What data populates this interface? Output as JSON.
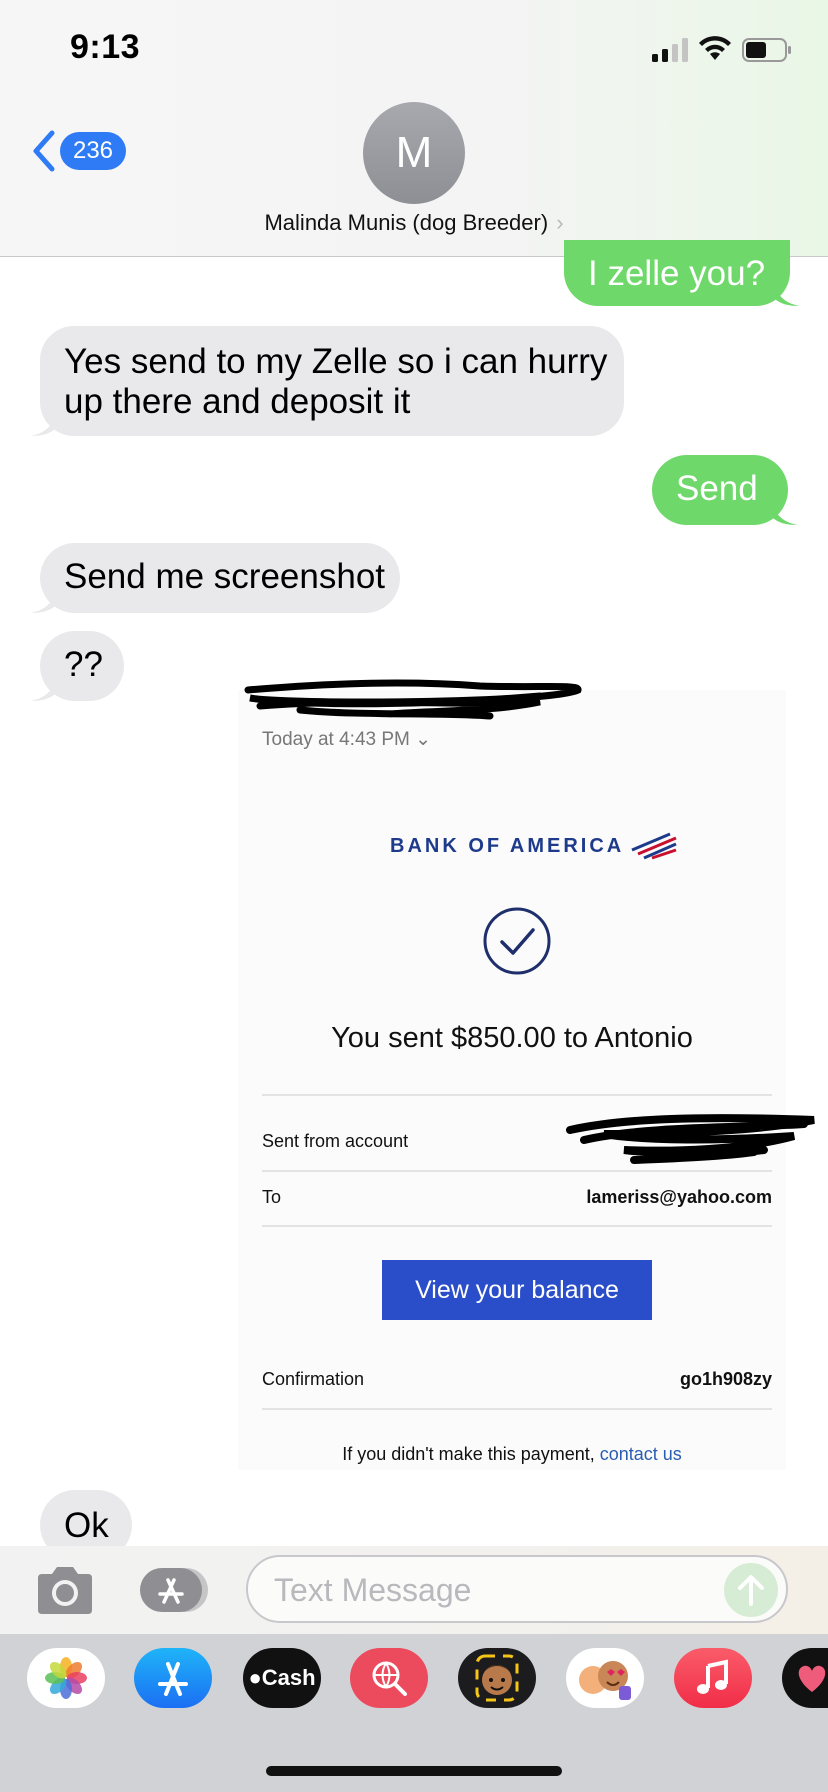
{
  "status_bar": {
    "time": "9:13"
  },
  "nav": {
    "back_count": "236",
    "avatar_initial": "M",
    "contact_name": "Malinda Munis (dog Breeder)"
  },
  "messages": [
    {
      "direction": "sent",
      "text": "I zelle you?"
    },
    {
      "direction": "received",
      "text_line1": "Yes send to my Zelle so i can hurry",
      "text_line2": "up there and deposit it"
    },
    {
      "direction": "sent",
      "text": "Send"
    },
    {
      "direction": "received",
      "text": "Send me screenshot"
    },
    {
      "direction": "received",
      "text": "??"
    },
    {
      "direction": "received",
      "text": "Ok"
    }
  ],
  "bank_screenshot": {
    "timestamp": "Today at 4:43 PM",
    "bank_name": "BANK OF AMERICA",
    "headline": "You sent $850.00 to Antonio",
    "sent_from_label": "Sent from account",
    "to_label": "To",
    "to_value": "lameriss@yahoo.com",
    "view_balance_label": "View your balance",
    "confirmation_label": "Confirmation",
    "confirmation_value": "go1h908zy",
    "footer_text": "If you didn't make this payment, ",
    "footer_link": "contact us"
  },
  "input": {
    "placeholder": "Text Message"
  },
  "app_tray": {
    "apps": [
      "photos-app",
      "app-store-app",
      "apple-cash-app",
      "search-images-app",
      "memoji-app",
      "animoji-app",
      "music-app",
      "digital-touch-app"
    ],
    "cash_label": "Cash"
  },
  "colors": {
    "sent_bubble": "#6fd86a",
    "received_bubble": "#e9e9eb",
    "ios_blue": "#2f7bf6",
    "boa_navy": "#1e3a8a",
    "boa_button": "#2a4ec9"
  }
}
